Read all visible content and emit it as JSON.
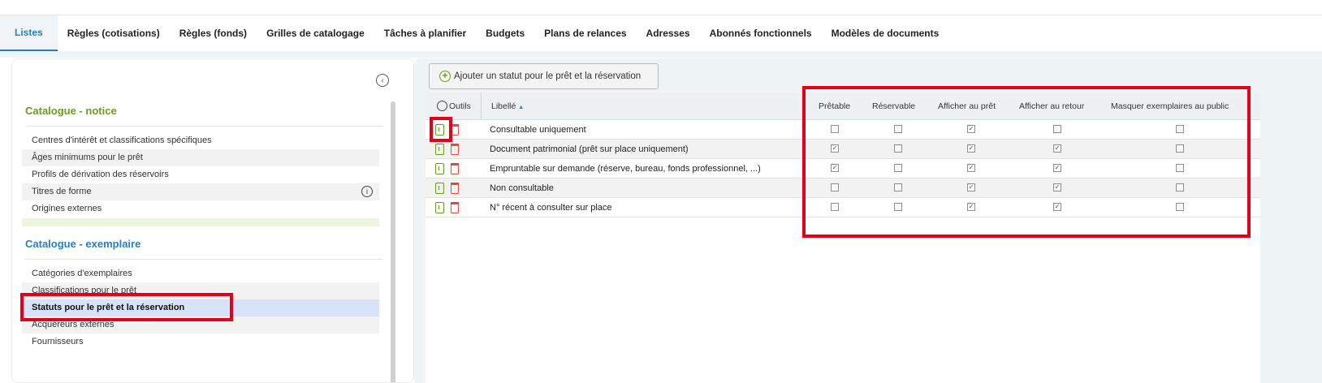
{
  "tabs": [
    {
      "label": "Listes",
      "active": true
    },
    {
      "label": "Règles (cotisations)"
    },
    {
      "label": "Règles (fonds)"
    },
    {
      "label": "Grilles de catalogage"
    },
    {
      "label": "Tâches à planifier"
    },
    {
      "label": "Budgets"
    },
    {
      "label": "Plans de relances"
    },
    {
      "label": "Adresses"
    },
    {
      "label": "Abonnés fonctionnels"
    },
    {
      "label": "Modèles de documents"
    }
  ],
  "sidebar": {
    "collapse_icon": "chevron-left-icon",
    "sections": [
      {
        "title": "Catalogue - notice",
        "color": "#6a9b23",
        "items": [
          {
            "label": "Centres d'intérêt et classifications spécifiques"
          },
          {
            "label": "Âges minimums pour le prêt"
          },
          {
            "label": "Profils de dérivation des réservoirs"
          },
          {
            "label": "Titres de forme",
            "info_icon": true
          },
          {
            "label": "Origines externes"
          }
        ]
      },
      {
        "title": "Catalogue - exemplaire",
        "color": "#2a7fc0",
        "items": [
          {
            "label": "Catégories d'exemplaires"
          },
          {
            "label": "Classifications pour le prêt"
          },
          {
            "label": "Statuts pour le prêt et la réservation",
            "selected": true
          },
          {
            "label": "Acquéreurs externes"
          },
          {
            "label": "Fournisseurs"
          }
        ]
      }
    ]
  },
  "main": {
    "add_button_label": "Ajouter un statut pour le prêt et la réservation",
    "table": {
      "tools_label": "Outils",
      "label_header": "Libellé",
      "sort_indicator": "▲",
      "columns": [
        "Prêtable",
        "Réservable",
        "Afficher au prêt",
        "Afficher au retour",
        "Masquer exemplaires au public"
      ],
      "rows": [
        {
          "label": "Consultable uniquement",
          "values": [
            false,
            false,
            true,
            false,
            false
          ]
        },
        {
          "label": "Document patrimonial (prêt sur place uniquement)",
          "values": [
            true,
            false,
            true,
            true,
            false
          ]
        },
        {
          "label": "Empruntable sur demande (réserve, bureau, fonds professionnel, ...)",
          "values": [
            true,
            false,
            true,
            true,
            false
          ]
        },
        {
          "label": "Non consultable",
          "values": [
            false,
            false,
            true,
            true,
            false
          ]
        },
        {
          "label": "N° récent à consulter sur place",
          "values": [
            false,
            false,
            true,
            true,
            false
          ]
        }
      ]
    }
  },
  "colors": {
    "accent_blue": "#2a7fc0",
    "accent_green": "#6a9b23",
    "delete_red": "#e14a3c",
    "annotation_red": "#e3001b"
  }
}
